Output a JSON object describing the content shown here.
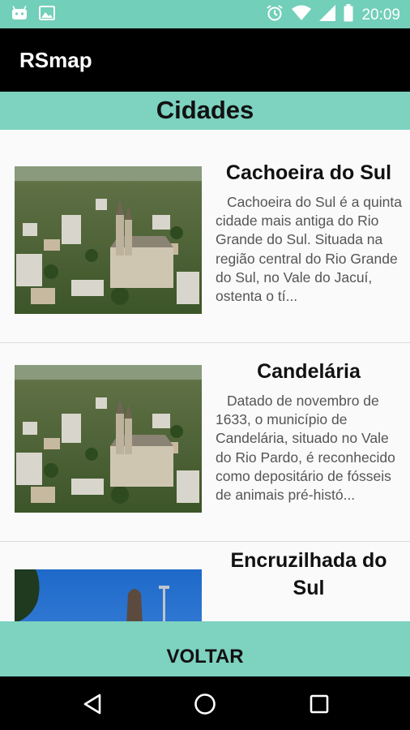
{
  "status_bar": {
    "time": "20:09",
    "left_icons": [
      "android-icon",
      "image-icon"
    ],
    "right_icons": [
      "alarm-icon",
      "wifi-icon",
      "signal-icon",
      "battery-icon"
    ]
  },
  "app": {
    "title": "RSmap"
  },
  "section": {
    "title": "Cidades"
  },
  "cities": [
    {
      "name": "Cachoeira do Sul",
      "description": "Cachoeira do Sul é a quinta cidade mais antiga do Rio Grande do Sul. Situada na região central do Rio Grande do Sul, no Vale do Jacuí, ostenta o tí..."
    },
    {
      "name": "Candelária",
      "description": "Datado de novembro de 1633, o município de Candelária, situado no Vale do Rio Pardo, é reconhecido como depositário de fósseis de animais pré-histó..."
    },
    {
      "name": "Encruzilhada do Sul",
      "description": ""
    }
  ],
  "bottom_button": {
    "label": "VOLTAR"
  },
  "nav": {
    "icons": [
      "back-icon",
      "home-icon",
      "recents-icon"
    ]
  },
  "colors": {
    "accent": "#7dd2c0",
    "status_bar": "#72cfb9",
    "app_bar": "#000000",
    "nav_bar": "#000000"
  }
}
